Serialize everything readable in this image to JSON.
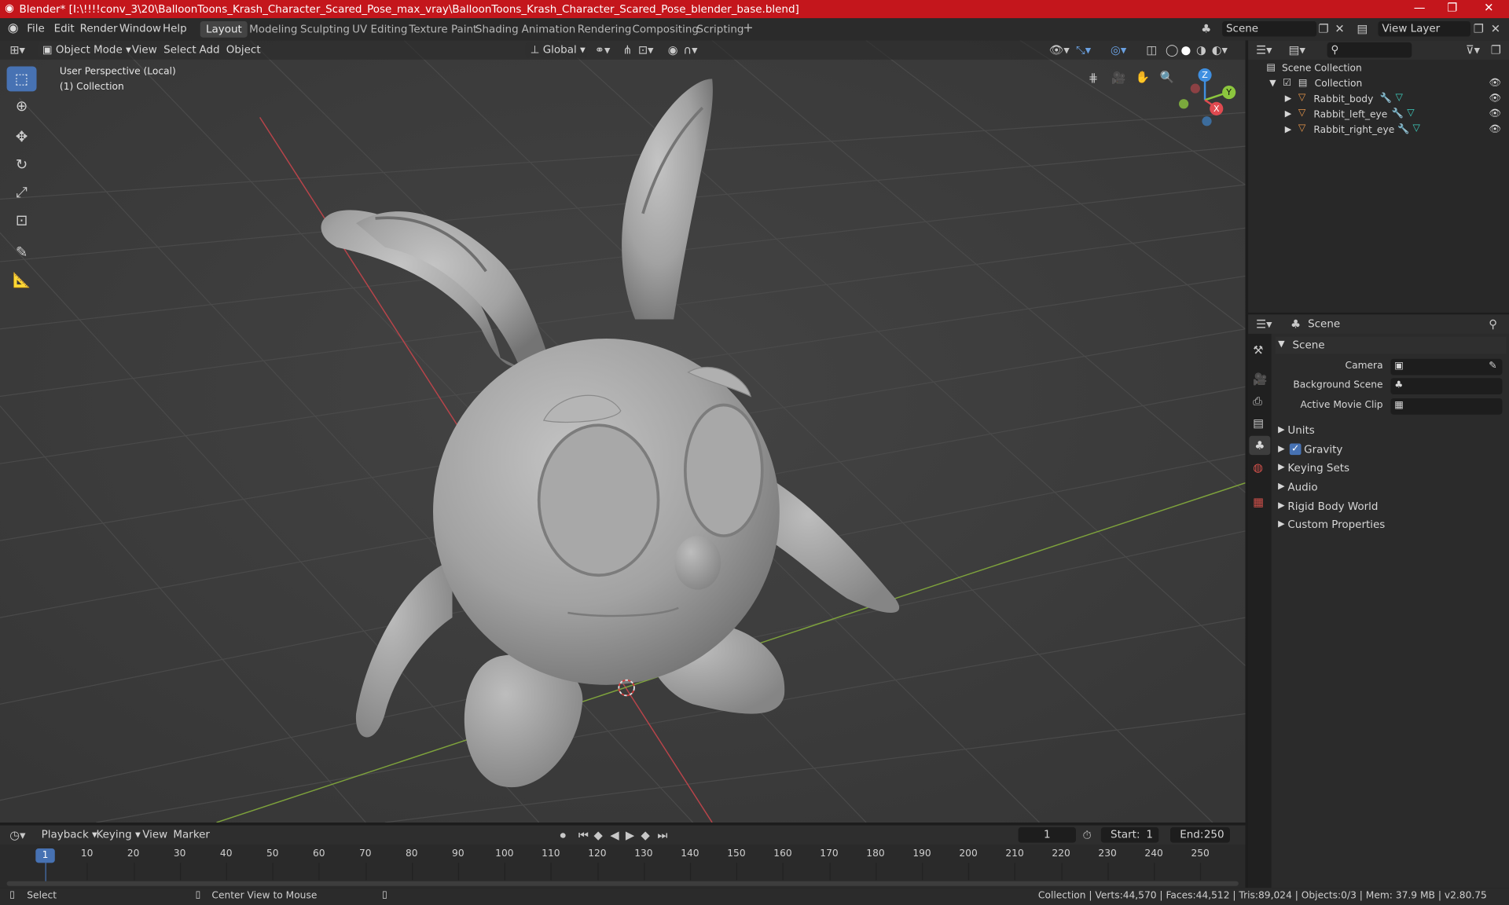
{
  "window": {
    "title": "Blender* [I:\\!!!!conv_3\\20\\BalloonToons_Krash_Character_Scared_Pose_max_vray\\BalloonToons_Krash_Character_Scared_Pose_blender_base.blend]",
    "minimize": "—",
    "maximize": "❐",
    "close": "✕"
  },
  "menu": [
    "File",
    "Edit",
    "Render",
    "Window",
    "Help"
  ],
  "workspaces": [
    "Layout",
    "Modeling",
    "Sculpting",
    "UV Editing",
    "Texture Paint",
    "Shading",
    "Animation",
    "Rendering",
    "Compositing",
    "Scripting"
  ],
  "workspace_add": "+",
  "scene_field": "Scene",
  "view_layer_field": "View Layer",
  "viewport": {
    "mode": "Object Mode",
    "menus": [
      "View",
      "Select",
      "Add",
      "Object"
    ],
    "transform": "Global",
    "perspective_label": "User Perspective (Local)",
    "collection_label": "(1) Collection",
    "gizmo": {
      "x": "X",
      "y": "Y",
      "z": "Z"
    }
  },
  "outliner": {
    "search_placeholder": "",
    "root": "Scene Collection",
    "collection": "Collection",
    "objects": [
      "Rabbit_body",
      "Rabbit_left_eye",
      "Rabbit_right_eye"
    ]
  },
  "properties": {
    "header": "Scene",
    "section": "Scene",
    "camera_label": "Camera",
    "background_label": "Background Scene",
    "movieclip_label": "Active Movie Clip",
    "panels": [
      "Units",
      "Gravity",
      "Keying Sets",
      "Audio",
      "Rigid Body World",
      "Custom Properties"
    ],
    "gravity_checked": true
  },
  "timeline": {
    "menus": [
      "Playback",
      "Keying",
      "View",
      "Marker"
    ],
    "current_frame": "1",
    "start_label": "Start:",
    "start": "1",
    "end_label": "End:",
    "end": "250",
    "ruler": [
      "1",
      "10",
      "20",
      "30",
      "40",
      "50",
      "60",
      "70",
      "80",
      "90",
      "100",
      "110",
      "120",
      "130",
      "140",
      "150",
      "160",
      "170",
      "180",
      "190",
      "200",
      "210",
      "220",
      "230",
      "240",
      "250"
    ]
  },
  "status": {
    "select": "Select",
    "center": "Center View to Mouse",
    "stats": "Collection | Verts:44,570 | Faces:44,512 | Tris:89,024 | Objects:0/3 | Mem: 37.9 MB | v2.80.75"
  },
  "colors": {
    "accent": "#4772b3",
    "titlebar": "#c4161c",
    "axis_x": "#e04a50",
    "axis_y": "#8cc63e",
    "axis_z": "#3f8fe0"
  }
}
